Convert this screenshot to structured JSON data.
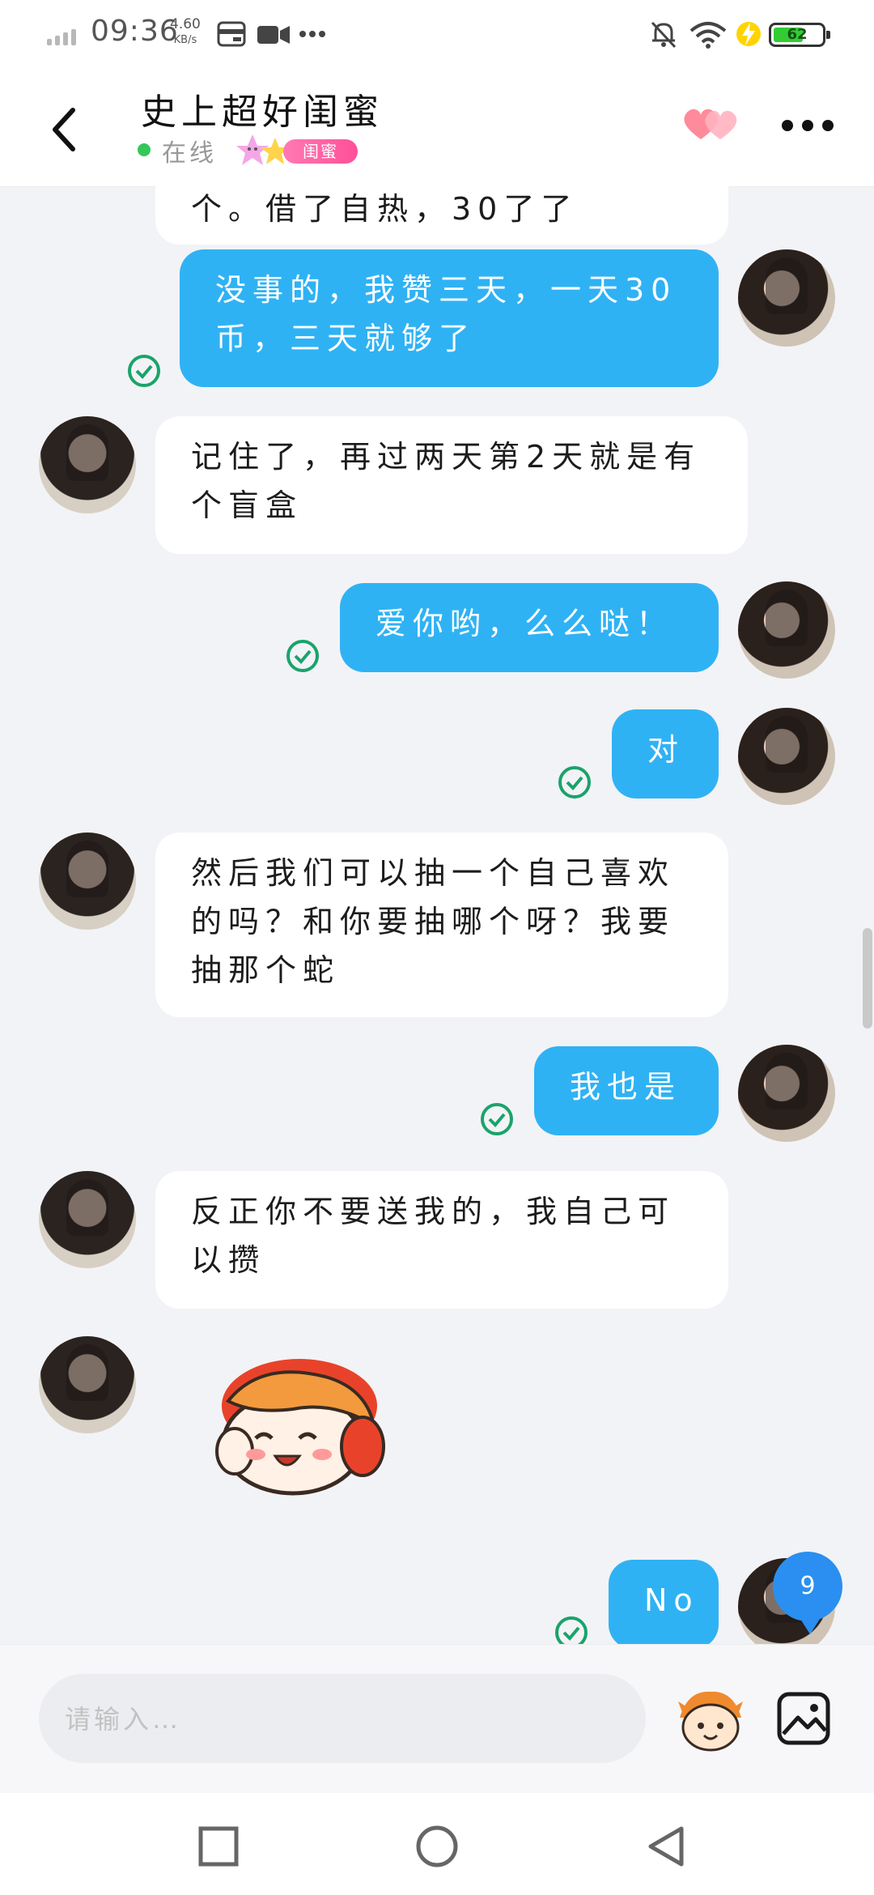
{
  "status_bar": {
    "time": "09:36",
    "speed_value": "4.60",
    "speed_unit": "KB/s",
    "battery": "62"
  },
  "header": {
    "title": "史上超好闺蜜",
    "status": "在线",
    "relation_tag": "闺蜜"
  },
  "messages": [
    {
      "id": "m0",
      "side": "in",
      "text": "个。借了自热，30了了"
    },
    {
      "id": "m1",
      "side": "out",
      "text": "没事的，我赞三天，一天30币，三天就够了"
    },
    {
      "id": "m2",
      "side": "in",
      "text": "记住了，再过两天第2天就是有个盲盒"
    },
    {
      "id": "m3",
      "side": "out",
      "text": "爱你哟，么么哒！"
    },
    {
      "id": "m4",
      "side": "out",
      "text": "对"
    },
    {
      "id": "m5",
      "side": "in",
      "text": "然后我们可以抽一个自己喜欢的吗？和你要抽哪个呀？我要抽那个蛇"
    },
    {
      "id": "m6",
      "side": "out",
      "text": "我也是"
    },
    {
      "id": "m7",
      "side": "in",
      "text": "反正你不要送我的，我自己可以攒"
    },
    {
      "id": "m8",
      "side": "in",
      "type": "sticker",
      "icon": "cartoon-sticker"
    },
    {
      "id": "m9",
      "side": "out",
      "text": "No"
    }
  ],
  "unread_badge": "9",
  "input": {
    "placeholder": "请输入…"
  },
  "colors": {
    "outgoing_bubble": "#2fb2f4",
    "incoming_bubble": "#ffffff",
    "background": "#f2f3f6",
    "read_check": "#1aa36b",
    "badge": "#2a8ff0"
  },
  "icons": {
    "back": "back-arrow-icon",
    "favorite": "hearts-icon",
    "more": "more-dots-icon",
    "emoji": "emoji-sticker-icon",
    "image": "image-icon",
    "nav_recent": "square-icon",
    "nav_home": "circle-icon",
    "nav_back": "triangle-back-icon"
  }
}
